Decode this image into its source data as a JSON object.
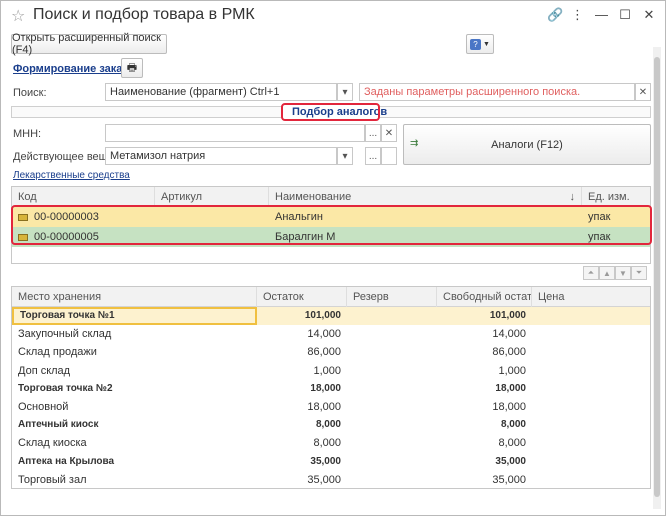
{
  "window": {
    "title": "Поиск и подбор товара в РМК"
  },
  "toolbar": {
    "advanced_search_label": "Открыть расширенный поиск (F4)"
  },
  "order": {
    "link_label": "Формирование заказа"
  },
  "search": {
    "label": "Поиск:",
    "mode_value": "Наименование (фрагмент) Ctrl+1",
    "params_text": "Заданы параметры расширенного поиска."
  },
  "analogs_section": {
    "title": "Подбор аналогов"
  },
  "mnn": {
    "label": "МНН:",
    "value": ""
  },
  "substance": {
    "label": "Действующее вещ-во:",
    "value": "Метамизол натрия"
  },
  "analogs_button": {
    "label": "Аналоги (F12)"
  },
  "drugs_link": {
    "label": "Лекарственные средства"
  },
  "products_table": {
    "columns": [
      "Код",
      "Артикул",
      "Наименование",
      "Ед. изм."
    ],
    "sort_indicator": "↓",
    "rows": [
      {
        "code": "00-00000003",
        "article": "",
        "name": "Анальгин",
        "unit": "упак"
      },
      {
        "code": "00-00000005",
        "article": "",
        "name": "Баралгин М",
        "unit": "упак"
      }
    ]
  },
  "stock_table": {
    "columns": [
      "Место хранения",
      "Остаток",
      "Резерв",
      "Свободный остаток",
      "Цена"
    ],
    "rows": [
      {
        "place": "Торговая точка №1",
        "rest": "101,000",
        "reserve": "",
        "free": "101,000",
        "price": "",
        "bold": true
      },
      {
        "place": "Закупочный склад",
        "rest": "14,000",
        "reserve": "",
        "free": "14,000",
        "price": "",
        "bold": false
      },
      {
        "place": "Склад продажи",
        "rest": "86,000",
        "reserve": "",
        "free": "86,000",
        "price": "",
        "bold": false
      },
      {
        "place": "Доп склад",
        "rest": "1,000",
        "reserve": "",
        "free": "1,000",
        "price": "",
        "bold": false
      },
      {
        "place": "Торговая точка №2",
        "rest": "18,000",
        "reserve": "",
        "free": "18,000",
        "price": "",
        "bold": true
      },
      {
        "place": "Основной",
        "rest": "18,000",
        "reserve": "",
        "free": "18,000",
        "price": "",
        "bold": false
      },
      {
        "place": "Аптечный киоск",
        "rest": "8,000",
        "reserve": "",
        "free": "8,000",
        "price": "",
        "bold": true
      },
      {
        "place": "Склад киоска",
        "rest": "8,000",
        "reserve": "",
        "free": "8,000",
        "price": "",
        "bold": false
      },
      {
        "place": "Аптека на Крылова",
        "rest": "35,000",
        "reserve": "",
        "free": "35,000",
        "price": "",
        "bold": true
      },
      {
        "place": "Торговый зал",
        "rest": "35,000",
        "reserve": "",
        "free": "35,000",
        "price": "",
        "bold": false
      }
    ]
  },
  "colors": {
    "accent_link": "#1a3e8c",
    "selected_row": "#fbe8a6",
    "green_row": "#c6e2c2",
    "highlight_outline": "#e2263c",
    "stock_selected": "#fdf2cf"
  }
}
